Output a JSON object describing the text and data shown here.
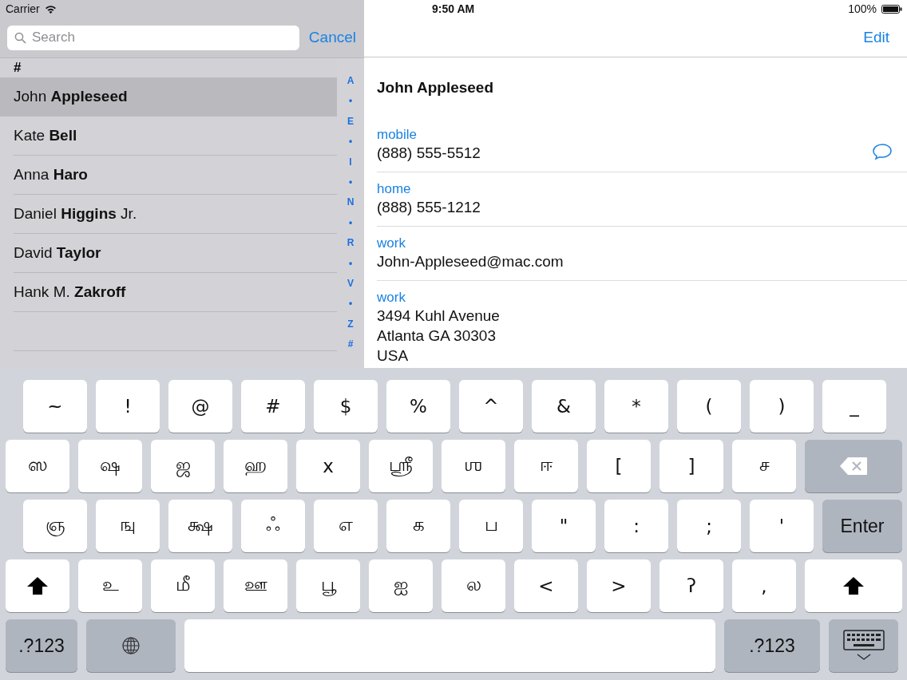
{
  "status_bar": {
    "carrier": "Carrier",
    "time": "9:50 AM",
    "battery": "100%"
  },
  "search": {
    "placeholder": "Search",
    "cancel": "Cancel"
  },
  "contacts": {
    "section": "#",
    "rows": [
      {
        "name": "John **Appleseed**",
        "selected": true
      },
      {
        "name": "Kate **Bell**",
        "selected": false
      },
      {
        "name": "Anna **Haro**",
        "selected": false
      },
      {
        "name": "Daniel **Higgins** Jr.",
        "selected": false
      },
      {
        "name": "David **Taylor**",
        "selected": false
      },
      {
        "name": "Hank M. **Zakroff**",
        "selected": false
      }
    ],
    "index": [
      "A",
      "•",
      "E",
      "•",
      "I",
      "•",
      "N",
      "•",
      "R",
      "•",
      "V",
      "•",
      "Z",
      "#"
    ]
  },
  "detail": {
    "edit": "Edit",
    "name": "John Appleseed",
    "fields": [
      {
        "label": "mobile",
        "lines": [
          "(888) 555-5512"
        ],
        "message_button": true
      },
      {
        "label": "home",
        "lines": [
          "(888) 555-1212"
        ]
      },
      {
        "label": "work",
        "lines": [
          "John-Appleseed@mac.com"
        ]
      },
      {
        "label": "work",
        "lines": [
          "3494 Kuhl Avenue",
          "Atlanta GA 30303",
          "USA"
        ]
      }
    ]
  },
  "keyboard": {
    "key_rows": [
      [
        {
          "kind": "char",
          "label": "~"
        },
        {
          "kind": "char",
          "label": "!"
        },
        {
          "kind": "char",
          "label": "@"
        },
        {
          "kind": "char",
          "label": "#"
        },
        {
          "kind": "char",
          "label": "$"
        },
        {
          "kind": "char",
          "label": "%"
        },
        {
          "kind": "char",
          "label": "^"
        },
        {
          "kind": "char",
          "label": "&"
        },
        {
          "kind": "char",
          "label": "*"
        },
        {
          "kind": "char",
          "label": "("
        },
        {
          "kind": "char",
          "label": ")"
        },
        {
          "kind": "char",
          "label": "_"
        }
      ],
      [
        {
          "kind": "char",
          "label": "ஸ"
        },
        {
          "kind": "char",
          "label": "ஷ"
        },
        {
          "kind": "char",
          "label": "ஜ"
        },
        {
          "kind": "char",
          "label": "ஹ"
        },
        {
          "kind": "char",
          "label": "x"
        },
        {
          "kind": "char",
          "label": "ஸ்ரீ"
        },
        {
          "kind": "char",
          "label": "ஶ"
        },
        {
          "kind": "char",
          "label": "ஈ"
        },
        {
          "kind": "char",
          "label": "["
        },
        {
          "kind": "char",
          "label": "]"
        },
        {
          "kind": "char",
          "label": "ச"
        },
        {
          "kind": "delete"
        }
      ],
      [
        {
          "kind": "char",
          "label": "ஞ"
        },
        {
          "kind": "char",
          "label": "ஙு"
        },
        {
          "kind": "char",
          "label": "க்ஷ"
        },
        {
          "kind": "char",
          "label": "ஃ"
        },
        {
          "kind": "char",
          "label": "எ"
        },
        {
          "kind": "char",
          "label": "க"
        },
        {
          "kind": "char",
          "label": "ப"
        },
        {
          "kind": "char",
          "label": "\""
        },
        {
          "kind": "char",
          "label": ":"
        },
        {
          "kind": "char",
          "label": ";"
        },
        {
          "kind": "char",
          "label": "'"
        },
        {
          "kind": "enter",
          "label": "Enter"
        }
      ],
      [
        {
          "kind": "shift"
        },
        {
          "kind": "char",
          "label": "உ"
        },
        {
          "kind": "char",
          "label": "மீ"
        },
        {
          "kind": "char",
          "label": "ஊ"
        },
        {
          "kind": "char",
          "label": "பூ"
        },
        {
          "kind": "char",
          "label": "ஐ"
        },
        {
          "kind": "char",
          "label": "ல"
        },
        {
          "kind": "char",
          "label": "<"
        },
        {
          "kind": "char",
          "label": ">"
        },
        {
          "kind": "char",
          "label": "ʔ"
        },
        {
          "kind": "char",
          "label": ","
        },
        {
          "kind": "shift"
        }
      ],
      [
        {
          "kind": "mode",
          "label": ".?123"
        },
        {
          "kind": "globe"
        },
        {
          "kind": "space"
        },
        {
          "kind": "mode",
          "label": ".?123"
        },
        {
          "kind": "hide"
        }
      ]
    ]
  }
}
